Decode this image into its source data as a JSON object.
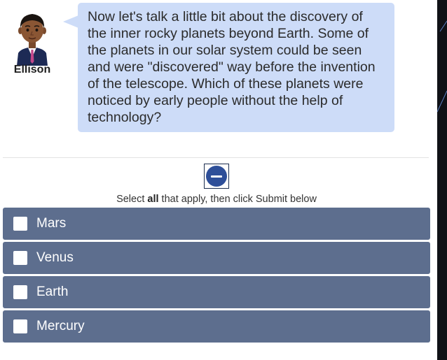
{
  "character": {
    "name": "Ellison",
    "avatar_icon": "person-avatar-icon"
  },
  "speech": {
    "lines": [
      "Now let's talk a little bit about the discovery of",
      "the inner rocky planets beyond Earth. Some of",
      "the planets in our solar system could be seen",
      "and were \"discovered\" way before the invention",
      "of the telescope. Which of these planets were",
      "noticed by early people without the help of",
      "technology?"
    ]
  },
  "collapse_button": {
    "icon": "minus-circle-icon"
  },
  "instruction": {
    "prefix": "Select ",
    "bold": "all",
    "suffix": " that apply, then click Submit below"
  },
  "options": [
    {
      "label": "Mars",
      "checked": false
    },
    {
      "label": "Venus",
      "checked": false
    },
    {
      "label": "Earth",
      "checked": false
    },
    {
      "label": "Mercury",
      "checked": false
    }
  ],
  "colors": {
    "bubble_bg": "#cddcf8",
    "option_bg": "#5d6e8e",
    "button_accent": "#2e4f99"
  }
}
